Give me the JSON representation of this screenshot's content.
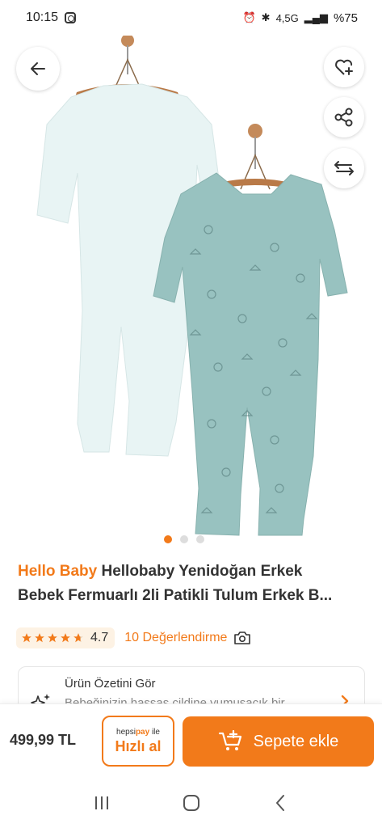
{
  "status_bar": {
    "time": "10:15",
    "network": "4,5G",
    "battery": "%75"
  },
  "gallery": {
    "image_count": 3,
    "active_index": 0
  },
  "product": {
    "brand": "Hello Baby",
    "title_line1": "Hellobaby Yenidoğan Erkek",
    "title_line2": "Bebek Fermuarlı 2li Patikli Tulum Erkek B..."
  },
  "rating": {
    "value": "4.7",
    "review_link": "10 Değerlendirme"
  },
  "summary": {
    "title": "Ürün Özetini Gör",
    "text": "Bebeğinizin hassas cildine yumuşacık bir"
  },
  "purchase": {
    "price": "499,99 TL",
    "hepsipay_prefix": "hepsi",
    "hepsipay_pay": "pay",
    "hepsipay_suffix": " ile",
    "quick_buy": "Hızlı al",
    "add_to_cart": "Sepete ekle"
  },
  "colors": {
    "accent": "#f27a1a",
    "rating_bg": "#fdf2e4"
  }
}
